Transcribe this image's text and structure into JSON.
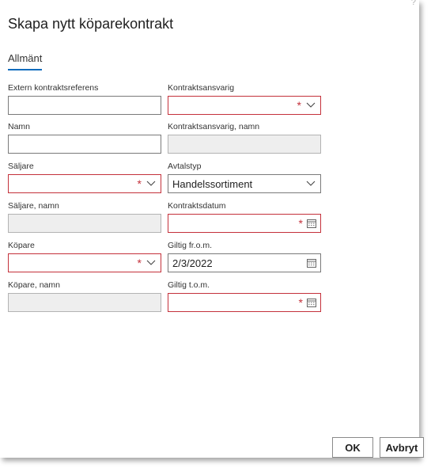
{
  "dialog": {
    "help_mark": "?",
    "title": "Skapa nytt köparekontrakt",
    "tab": "Allmänt"
  },
  "fields": {
    "extern_ref": {
      "label": "Extern kontraktsreferens",
      "value": ""
    },
    "kontraktsansvarig": {
      "label": "Kontraktsansvarig",
      "value": "",
      "required": true
    },
    "namn": {
      "label": "Namn",
      "value": ""
    },
    "kontraktsansvarig_namn": {
      "label": "Kontraktsansvarig, namn",
      "value": ""
    },
    "saljare": {
      "label": "Säljare",
      "value": "",
      "required": true
    },
    "avtalstyp": {
      "label": "Avtalstyp",
      "value": "Handelssortiment"
    },
    "saljare_namn": {
      "label": "Säljare, namn",
      "value": ""
    },
    "kontraktsdatum": {
      "label": "Kontraktsdatum",
      "value": "",
      "required": true
    },
    "kopare": {
      "label": "Köpare",
      "value": "",
      "required": true
    },
    "giltig_from": {
      "label": "Giltig fr.o.m.",
      "value": "2/3/2022"
    },
    "kopare_namn": {
      "label": "Köpare, namn",
      "value": ""
    },
    "giltig_tom": {
      "label": "Giltig t.o.m.",
      "value": "",
      "required": true
    }
  },
  "required_mark": "*",
  "buttons": {
    "ok": "OK",
    "cancel": "Avbryt"
  },
  "colors": {
    "accent": "#0f6cbd",
    "required": "#c4313b",
    "readonly_bg": "#eeeeee"
  },
  "icons": {
    "dropdown": "chevron-down-icon",
    "date": "calendar-icon"
  }
}
